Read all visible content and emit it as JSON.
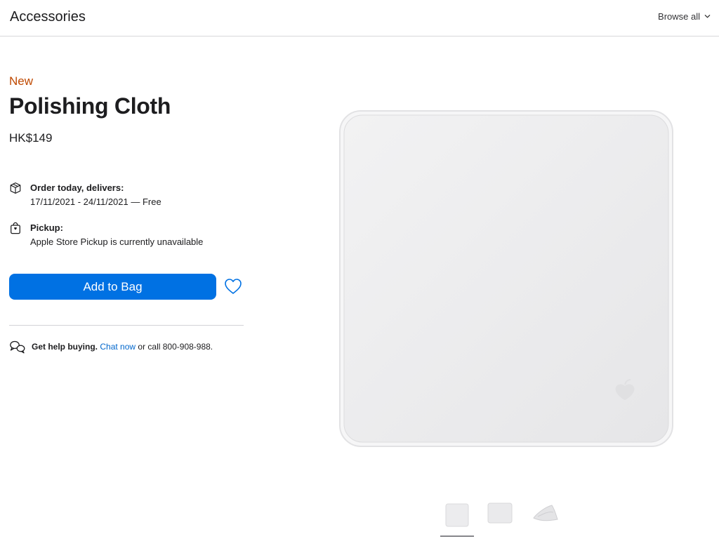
{
  "header": {
    "title": "Accessories",
    "browse_label": "Browse all"
  },
  "product": {
    "badge": "New",
    "name": "Polishing Cloth",
    "price": "HK$149"
  },
  "delivery": {
    "label": "Order today, delivers:",
    "detail": "17/11/2021 - 24/11/2021 — Free",
    "icon": "box-icon"
  },
  "pickup": {
    "label": "Pickup:",
    "detail": "Apple Store Pickup is currently unavailable",
    "icon": "store-bag-icon"
  },
  "actions": {
    "add_to_bag": "Add to Bag",
    "favorite_icon": "heart-icon"
  },
  "help": {
    "lead": "Get help buying.",
    "chat_link": "Chat now",
    "call_text": "or call 800-908-988."
  },
  "gallery": {
    "thumbnails": [
      "cloth-front",
      "cloth-back",
      "cloth-folded"
    ],
    "selected_index": 0
  },
  "colors": {
    "accent": "#0071e3",
    "new_badge": "#bf4800",
    "link": "#0066cc"
  }
}
